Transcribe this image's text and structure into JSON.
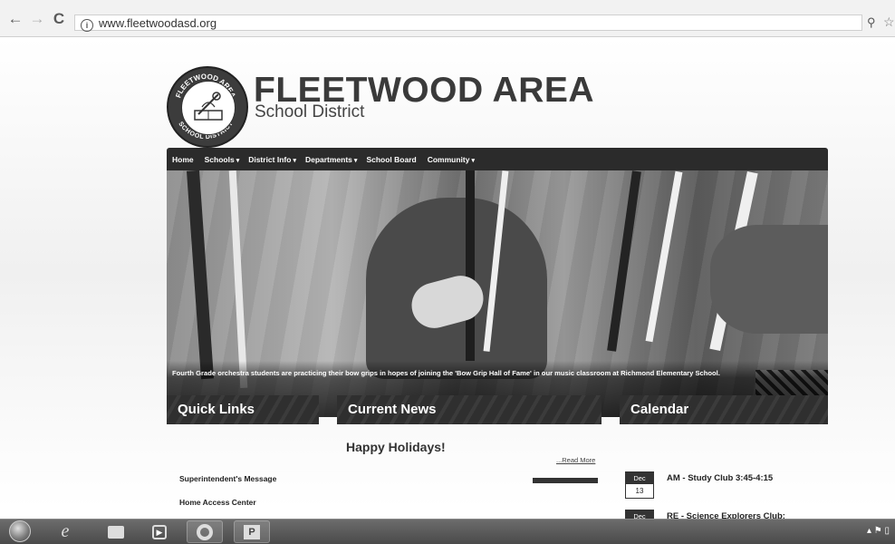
{
  "browser": {
    "back_icon": "←",
    "forward_icon": "→",
    "reload_icon": "C",
    "url": "www.fleetwoodasd.org",
    "info_icon": "i",
    "zoom_icon": "⚲",
    "star_icon": "☆"
  },
  "site": {
    "title": "FLEETWOOD AREA",
    "subtitle": "School District",
    "logo_text_top": "FLEETWOOD AREA",
    "logo_text_bottom": "SCHOOL DISTRICT"
  },
  "nav": {
    "items": [
      {
        "label": "Home",
        "caret": ""
      },
      {
        "label": "Schools",
        "caret": "▾"
      },
      {
        "label": "District Info",
        "caret": "▾"
      },
      {
        "label": "Departments",
        "caret": "▾"
      },
      {
        "label": "School Board",
        "caret": ""
      },
      {
        "label": "Community",
        "caret": "▾"
      }
    ]
  },
  "slider": {
    "caption": "Fourth Grade orchestra students are practicing their bow grips in hopes of joining the 'Bow Grip Hall of Fame' in our music classroom at Richmond Elementary School.",
    "prev": "‹",
    "next": "›"
  },
  "quick_links": {
    "heading": "Quick Links",
    "items": [
      "Superintendent's Message",
      "Home Access Center"
    ]
  },
  "news": {
    "heading": "Current News",
    "title": "Happy Holidays!",
    "read_more": "...Read More"
  },
  "calendar": {
    "heading": "Calendar",
    "events": [
      {
        "month": "Dec",
        "day": "13",
        "title": "AM - Study Club 3:45-4:15"
      },
      {
        "month": "Dec",
        "day": "",
        "title": "RE - Science Explorers Club:"
      }
    ]
  },
  "taskbar": {
    "tray_text": "▴  ⚑  ▯"
  }
}
